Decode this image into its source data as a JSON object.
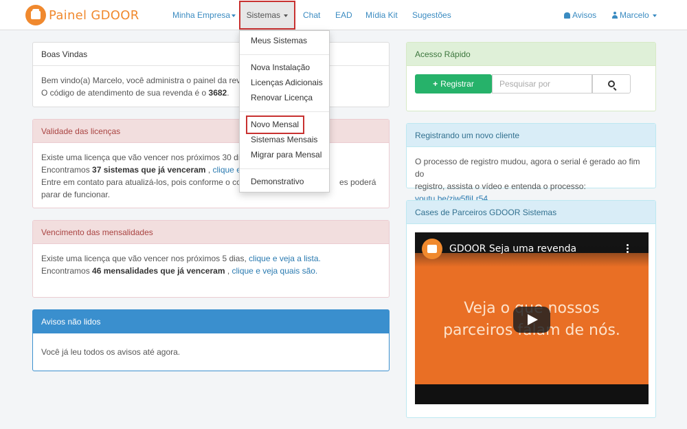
{
  "brand": {
    "name": "Painel GDOOR"
  },
  "nav": {
    "minha_empresa": "Minha Empresa",
    "sistemas": "Sistemas",
    "chat": "Chat",
    "ead": "EAD",
    "midia_kit": "Mídia Kit",
    "sugestoes": "Sugestões",
    "avisos": "Avisos",
    "user": "Marcelo"
  },
  "dropdown": {
    "items": [
      "Meus Sistemas",
      "Nova Instalação",
      "Licenças Adicionais",
      "Renovar Licença",
      "Novo Mensal",
      "Sistemas Mensais",
      "Migrar para Mensal",
      "Demonstrativo"
    ]
  },
  "boas_vindas": {
    "title": "Boas Vindas",
    "line1": "Bem vindo(a) Marcelo, você administra o painel da revenda",
    "line2_prefix": "O código de atendimento de sua revenda é o ",
    "code": "3682",
    "line2_suffix": "."
  },
  "validade": {
    "title": "Validade das licenças",
    "line1": "Existe uma licença que vão vencer nos próximos 30 dias,",
    "line1_link": "c",
    "line2_prefix": "Encontramos ",
    "line2_bold": "37 sistemas que já venceram",
    "line2_mid": " , ",
    "line2_link": "clique e veja q",
    "line3_left": "Entre em contato para atualizá-los, pois conforme o contra",
    "line3_right": "es poderá",
    "line4": "parar de funcionar."
  },
  "vencimento": {
    "title": "Vencimento das mensalidades",
    "line1": "Existe uma licença que vão vencer nos próximos 5 dias, ",
    "line1_link": "clique e veja a lista.",
    "line2_prefix": "Encontramos ",
    "line2_bold": "46 mensalidades que já venceram",
    "line2_mid": " , ",
    "line2_link": "clique e veja quais são."
  },
  "avisos_panel": {
    "title": "Avisos não lidos",
    "body": "Você já leu todos os avisos até agora."
  },
  "acesso_rapido": {
    "title": "Acesso Rápido",
    "register_label": "Registrar",
    "search_placeholder": "Pesquisar por"
  },
  "registrando": {
    "title": "Registrando um novo cliente",
    "line1": "O processo de registro mudou, agora o serial é gerado ao fim do",
    "line2_prefix": "registro, assista o vídeo e entenda o processo: ",
    "link": "youtu.be/zjw5fliLr54"
  },
  "cases": {
    "title": "Cases de Parceiros GDOOR Sistemas",
    "video_title": "GDOOR Seja uma revenda",
    "video_line1": "Veja o que nossos",
    "video_line2": "parceiros falam de nós."
  },
  "colors": {
    "accent_orange": "#f0892e",
    "link_blue": "#2a7ab0",
    "success_green": "#26b26a",
    "highlight_red": "#c8302f",
    "primary_blue": "#3a8fce"
  }
}
